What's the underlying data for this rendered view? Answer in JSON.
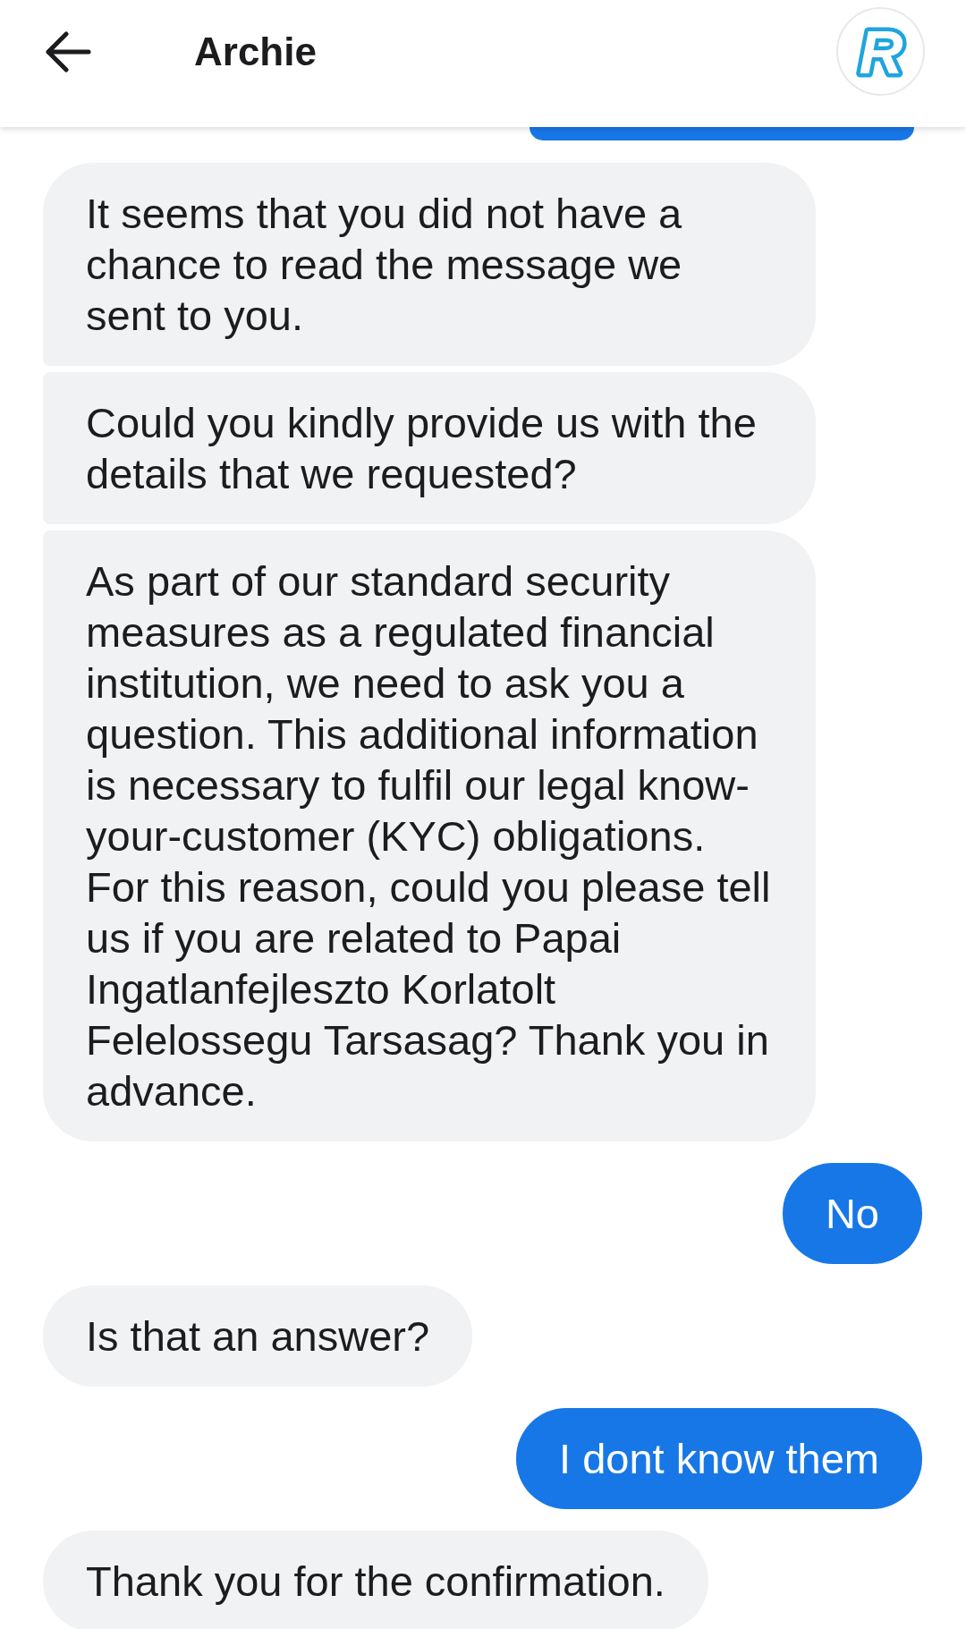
{
  "header": {
    "title": "Archie",
    "avatar": {
      "letter": "R"
    }
  },
  "messages": [
    {
      "kind": "sent",
      "clipped": true
    },
    {
      "kind": "received",
      "clipped": false,
      "text": "It seems that you did not have a chance to read the message we sent to you."
    },
    {
      "kind": "received",
      "clipped": false,
      "text": "Could you kindly provide us with the details that we requested?"
    },
    {
      "kind": "received",
      "clipped": false,
      "text": "As part of our standard security measures as a regulated financial institution, we need to ask you a question. This additional information is necessary to fulfil our legal know-your-customer (KYC) obligations. For this reason, could you please tell us if you are related to Papai Ingatlanfejleszto Korlatolt Felelossegu Tarsasag? Thank you in advance."
    },
    {
      "kind": "sent",
      "clipped": false,
      "text": "No"
    },
    {
      "kind": "received",
      "clipped": false,
      "text": "Is that an answer?"
    },
    {
      "kind": "sent",
      "clipped": false,
      "text": "I dont know them"
    },
    {
      "kind": "received",
      "clipped": false,
      "text": "Thank you for the confirmation."
    }
  ]
}
